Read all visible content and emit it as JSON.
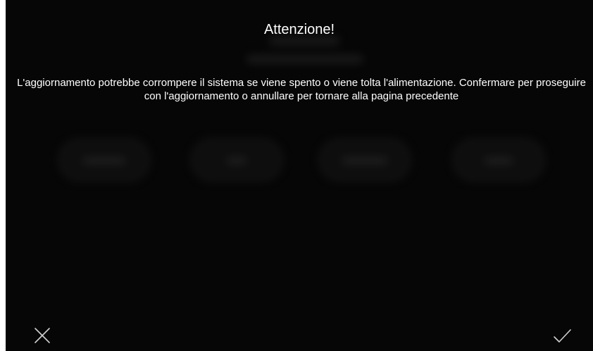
{
  "dialog": {
    "title": "Attenzione!",
    "message": "L'aggiornamento potrebbe corrompere il sistema se viene spento o viene tolta l'alimentazione. Confermare per proseguire con l'aggiornamento o annullare per tornare alla pagina precedente"
  },
  "actions": {
    "cancel_icon": "close-icon",
    "confirm_icon": "check-icon"
  },
  "colors": {
    "background": "#060606",
    "text": "#ffffff",
    "icon": "#d0d0d0"
  }
}
